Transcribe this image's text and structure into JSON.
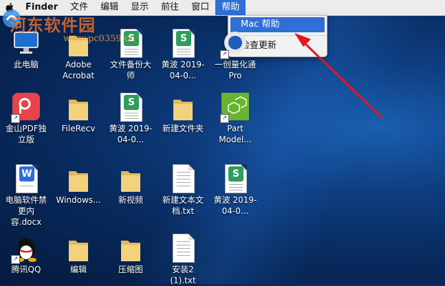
{
  "menubar": {
    "app_name": "Finder",
    "items": [
      "文件",
      "编辑",
      "显示",
      "前往",
      "窗口"
    ],
    "active_item": "帮助"
  },
  "help_menu": {
    "items": [
      "Mac 帮助",
      "检查更新"
    ]
  },
  "watermark": {
    "title": "河东软件园",
    "url": "www.pc0359.cn"
  },
  "desktop": {
    "icons": [
      {
        "label": "此电脑",
        "icon": "monitor-icon"
      },
      {
        "label": "Adobe Acrobat",
        "icon": "folder-icon"
      },
      {
        "label": "文件备份大师",
        "icon": "wps-spreadsheet-icon"
      },
      {
        "label": "黄波 2019-04-0...",
        "icon": "wps-spreadsheet-icon"
      },
      {
        "label": "一创量化通 Pro",
        "icon": "app-icon"
      },
      {
        "label": "金山PDF独立版",
        "icon": "pdf-app-icon"
      },
      {
        "label": "FileRecv",
        "icon": "folder-icon"
      },
      {
        "label": "黄波 2019-04-0...",
        "icon": "wps-spreadsheet-icon"
      },
      {
        "label": "新建文件夹",
        "icon": "folder-icon"
      },
      {
        "label": "Part Model...",
        "icon": "cube-app-icon"
      },
      {
        "label": "电脑软件禁更内容.docx",
        "icon": "word-doc-icon"
      },
      {
        "label": "Windows...",
        "icon": "folder-icon"
      },
      {
        "label": "新视频",
        "icon": "folder-icon"
      },
      {
        "label": "新建文本文档.txt",
        "icon": "text-file-icon"
      },
      {
        "label": "黄波 2019-04-0...",
        "icon": "wps-spreadsheet-icon"
      },
      {
        "label": "腾讯QQ",
        "icon": "qq-icon"
      },
      {
        "label": "编辑",
        "icon": "folder-icon"
      },
      {
        "label": "压缩图",
        "icon": "folder-icon"
      },
      {
        "label": "安装2 (1).txt",
        "icon": "text-file-icon"
      }
    ]
  },
  "colors": {
    "menu_highlight": "#2f6fd6",
    "arrow": "#e8141e"
  }
}
